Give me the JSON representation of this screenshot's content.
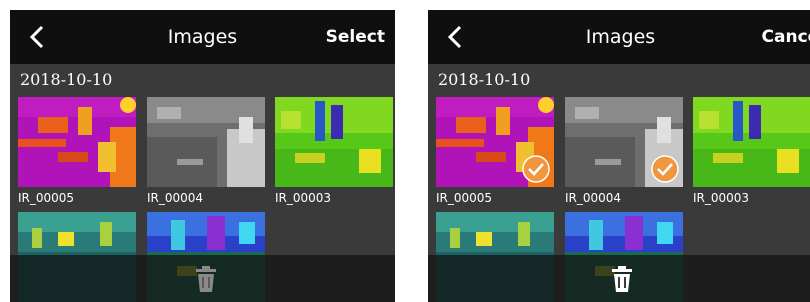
{
  "screens": [
    {
      "header": {
        "title": "Images",
        "action_label": "Select",
        "back_icon": "chevron-left-icon"
      },
      "date_group": "2018-10-10",
      "images": [
        {
          "name": "IR_00005",
          "palette": "ironbow-purple",
          "selected": false
        },
        {
          "name": "IR_00004",
          "palette": "grayscale",
          "selected": false
        },
        {
          "name": "IR_00003",
          "palette": "green-yellow",
          "selected": false
        },
        {
          "name": "",
          "palette": "teal",
          "selected": false
        },
        {
          "name": "",
          "palette": "blue",
          "selected": false
        }
      ],
      "delete_icon": "trash-icon",
      "delete_enabled": false
    },
    {
      "header": {
        "title": "Images",
        "action_label": "Cancel",
        "back_icon": "chevron-left-icon"
      },
      "date_group": "2018-10-10",
      "images": [
        {
          "name": "IR_00005",
          "palette": "ironbow-purple",
          "selected": true
        },
        {
          "name": "IR_00004",
          "palette": "grayscale",
          "selected": true
        },
        {
          "name": "IR_00003",
          "palette": "green-yellow",
          "selected": false
        },
        {
          "name": "",
          "palette": "teal",
          "selected": false
        },
        {
          "name": "",
          "palette": "blue",
          "selected": false
        }
      ],
      "delete_icon": "trash-icon",
      "delete_enabled": true
    }
  ],
  "colors": {
    "header_bg": "#0f0f0f",
    "panel_bg": "#3a3a3a",
    "check_badge": "#f0963c",
    "trash_disabled": "#8a8a8a",
    "trash_enabled": "#ffffff"
  }
}
